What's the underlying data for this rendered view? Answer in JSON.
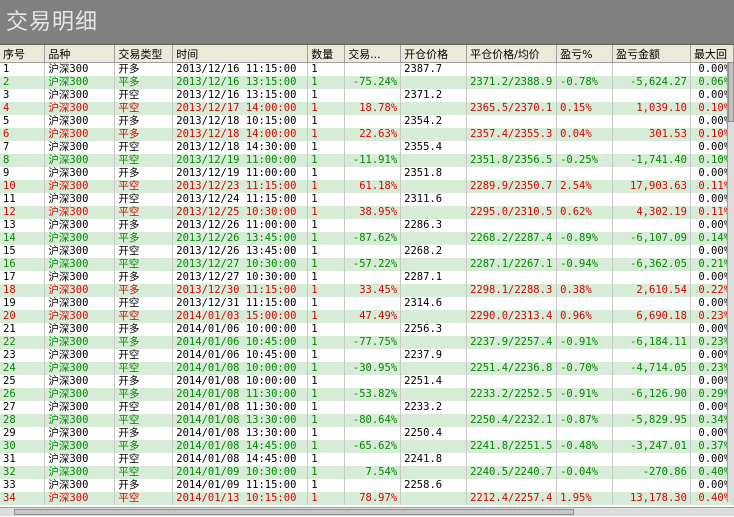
{
  "window": {
    "title": "交易明细"
  },
  "colors": {
    "row_alt": "#d6ecd6",
    "profit": "#e00000",
    "loss": "#008800"
  },
  "columns": [
    "序号",
    "品种",
    "交易类型",
    "时间",
    "数量",
    "交易...",
    "开仓价格",
    "平仓价格/均价",
    "盈亏%",
    "盈亏金额",
    "最大回"
  ],
  "rows": [
    {
      "c": "black",
      "v": [
        "1",
        "沪深300",
        "开多",
        "2013/12/16 11:15:00",
        "1",
        "",
        "2387.7",
        "",
        "",
        "",
        "0.00%"
      ]
    },
    {
      "c": "green",
      "v": [
        "2",
        "沪深300",
        "平多",
        "2013/12/16 13:15:00",
        "1",
        "-75.24%",
        "",
        "2371.2/2388.9",
        "-0.78%",
        "-5,624.27",
        "0.06%"
      ]
    },
    {
      "c": "black",
      "v": [
        "3",
        "沪深300",
        "开空",
        "2013/12/16 13:15:00",
        "1",
        "",
        "2371.2",
        "",
        "",
        "",
        "0.00%"
      ]
    },
    {
      "c": "red",
      "v": [
        "4",
        "沪深300",
        "平空",
        "2013/12/17 14:00:00",
        "1",
        "18.78%",
        "",
        "2365.5/2370.1",
        "0.15%",
        "1,039.10",
        "0.10%"
      ]
    },
    {
      "c": "black",
      "v": [
        "5",
        "沪深300",
        "开多",
        "2013/12/18 10:15:00",
        "1",
        "",
        "2354.2",
        "",
        "",
        "",
        "0.00%"
      ]
    },
    {
      "c": "red",
      "v": [
        "6",
        "沪深300",
        "平多",
        "2013/12/18 14:00:00",
        "1",
        "22.63%",
        "",
        "2357.4/2355.3",
        "0.04%",
        "301.53",
        "0.10%"
      ]
    },
    {
      "c": "black",
      "v": [
        "7",
        "沪深300",
        "开空",
        "2013/12/18 14:30:00",
        "1",
        "",
        "2355.4",
        "",
        "",
        "",
        "0.00%"
      ]
    },
    {
      "c": "green",
      "v": [
        "8",
        "沪深300",
        "平空",
        "2013/12/19 11:00:00",
        "1",
        "-11.91%",
        "",
        "2351.8/2356.5",
        "-0.25%",
        "-1,741.40",
        "0.10%"
      ]
    },
    {
      "c": "black",
      "v": [
        "9",
        "沪深300",
        "开多",
        "2013/12/19 11:00:00",
        "1",
        "",
        "2351.8",
        "",
        "",
        "",
        "0.00%"
      ]
    },
    {
      "c": "red",
      "v": [
        "10",
        "沪深300",
        "平空",
        "2013/12/23 11:15:00",
        "1",
        "61.18%",
        "",
        "2289.9/2350.7",
        "2.54%",
        "17,903.63",
        "0.11%"
      ]
    },
    {
      "c": "black",
      "v": [
        "11",
        "沪深300",
        "开空",
        "2013/12/24 11:15:00",
        "1",
        "",
        "2311.6",
        "",
        "",
        "",
        "0.00%"
      ]
    },
    {
      "c": "red",
      "v": [
        "12",
        "沪深300",
        "平空",
        "2013/12/25 10:30:00",
        "1",
        "38.95%",
        "",
        "2295.0/2310.5",
        "0.62%",
        "4,302.19",
        "0.11%"
      ]
    },
    {
      "c": "black",
      "v": [
        "13",
        "沪深300",
        "开多",
        "2013/12/26 11:00:00",
        "1",
        "",
        "2286.3",
        "",
        "",
        "",
        "0.00%"
      ]
    },
    {
      "c": "green",
      "v": [
        "14",
        "沪深300",
        "平多",
        "2013/12/26 13:45:00",
        "1",
        "-87.62%",
        "",
        "2268.2/2287.4",
        "-0.89%",
        "-6,107.09",
        "0.14%"
      ]
    },
    {
      "c": "black",
      "v": [
        "15",
        "沪深300",
        "开空",
        "2013/12/26 13:45:00",
        "1",
        "",
        "2268.2",
        "",
        "",
        "",
        "0.00%"
      ]
    },
    {
      "c": "green",
      "v": [
        "16",
        "沪深300",
        "平空",
        "2013/12/27 10:30:00",
        "1",
        "-57.22%",
        "",
        "2287.1/2267.1",
        "-0.94%",
        "-6,362.05",
        "0.21%"
      ]
    },
    {
      "c": "black",
      "v": [
        "17",
        "沪深300",
        "开多",
        "2013/12/27 10:30:00",
        "1",
        "",
        "2287.1",
        "",
        "",
        "",
        "0.00%"
      ]
    },
    {
      "c": "red",
      "v": [
        "18",
        "沪深300",
        "平多",
        "2013/12/30 11:15:00",
        "1",
        "33.45%",
        "",
        "2298.1/2288.3",
        "0.38%",
        "2,610.54",
        "0.22%"
      ]
    },
    {
      "c": "black",
      "v": [
        "19",
        "沪深300",
        "开空",
        "2013/12/31 11:15:00",
        "1",
        "",
        "2314.6",
        "",
        "",
        "",
        "0.00%"
      ]
    },
    {
      "c": "red",
      "v": [
        "20",
        "沪深300",
        "平空",
        "2014/01/03 15:00:00",
        "1",
        "47.49%",
        "",
        "2290.0/2313.4",
        "0.96%",
        "6,690.18",
        "0.23%"
      ]
    },
    {
      "c": "black",
      "v": [
        "21",
        "沪深300",
        "开多",
        "2014/01/06 10:00:00",
        "1",
        "",
        "2256.3",
        "",
        "",
        "",
        "0.00%"
      ]
    },
    {
      "c": "green",
      "v": [
        "22",
        "沪深300",
        "平多",
        "2014/01/06 10:45:00",
        "1",
        "-77.75%",
        "",
        "2237.9/2257.4",
        "-0.91%",
        "-6,184.11",
        "0.23%"
      ]
    },
    {
      "c": "black",
      "v": [
        "23",
        "沪深300",
        "开空",
        "2014/01/06 10:45:00",
        "1",
        "",
        "2237.9",
        "",
        "",
        "",
        "0.00%"
      ]
    },
    {
      "c": "green",
      "v": [
        "24",
        "沪深300",
        "平空",
        "2014/01/08 10:00:00",
        "1",
        "-30.95%",
        "",
        "2251.4/2236.8",
        "-0.70%",
        "-4,714.05",
        "0.23%"
      ]
    },
    {
      "c": "black",
      "v": [
        "25",
        "沪深300",
        "开多",
        "2014/01/08 10:00:00",
        "1",
        "",
        "2251.4",
        "",
        "",
        "",
        "0.00%"
      ]
    },
    {
      "c": "green",
      "v": [
        "26",
        "沪深300",
        "平多",
        "2014/01/08 11:30:00",
        "1",
        "-53.82%",
        "",
        "2233.2/2252.5",
        "-0.91%",
        "-6,126.90",
        "0.29%"
      ]
    },
    {
      "c": "black",
      "v": [
        "27",
        "沪深300",
        "开空",
        "2014/01/08 11:30:00",
        "1",
        "",
        "2233.2",
        "",
        "",
        "",
        "0.00%"
      ]
    },
    {
      "c": "green",
      "v": [
        "28",
        "沪深300",
        "平空",
        "2014/01/08 13:30:00",
        "1",
        "-80.64%",
        "",
        "2250.4/2232.1",
        "-0.87%",
        "-5,829.95",
        "0.34%"
      ]
    },
    {
      "c": "black",
      "v": [
        "29",
        "沪深300",
        "开多",
        "2014/01/08 13:30:00",
        "1",
        "",
        "2250.4",
        "",
        "",
        "",
        "0.00%"
      ]
    },
    {
      "c": "green",
      "v": [
        "30",
        "沪深300",
        "平多",
        "2014/01/08 14:45:00",
        "1",
        "-65.62%",
        "",
        "2241.8/2251.5",
        "-0.48%",
        "-3,247.01",
        "0.37%"
      ]
    },
    {
      "c": "black",
      "v": [
        "31",
        "沪深300",
        "开空",
        "2014/01/08 14:45:00",
        "1",
        "",
        "2241.8",
        "",
        "",
        "",
        "0.00%"
      ]
    },
    {
      "c": "green",
      "v": [
        "32",
        "沪深300",
        "平空",
        "2014/01/09 10:30:00",
        "1",
        "7.54%",
        "",
        "2240.5/2240.7",
        "-0.04%",
        "-270.86",
        "0.40%"
      ]
    },
    {
      "c": "black",
      "v": [
        "33",
        "沪深300",
        "开多",
        "2014/01/09 11:15:00",
        "1",
        "",
        "2258.6",
        "",
        "",
        "",
        "0.00%"
      ]
    },
    {
      "c": "red",
      "v": [
        "34",
        "沪深300",
        "平空",
        "2014/01/13 10:15:00",
        "1",
        "78.97%",
        "",
        "2212.4/2257.4",
        "1.95%",
        "13,178.30",
        "0.40%"
      ]
    }
  ]
}
